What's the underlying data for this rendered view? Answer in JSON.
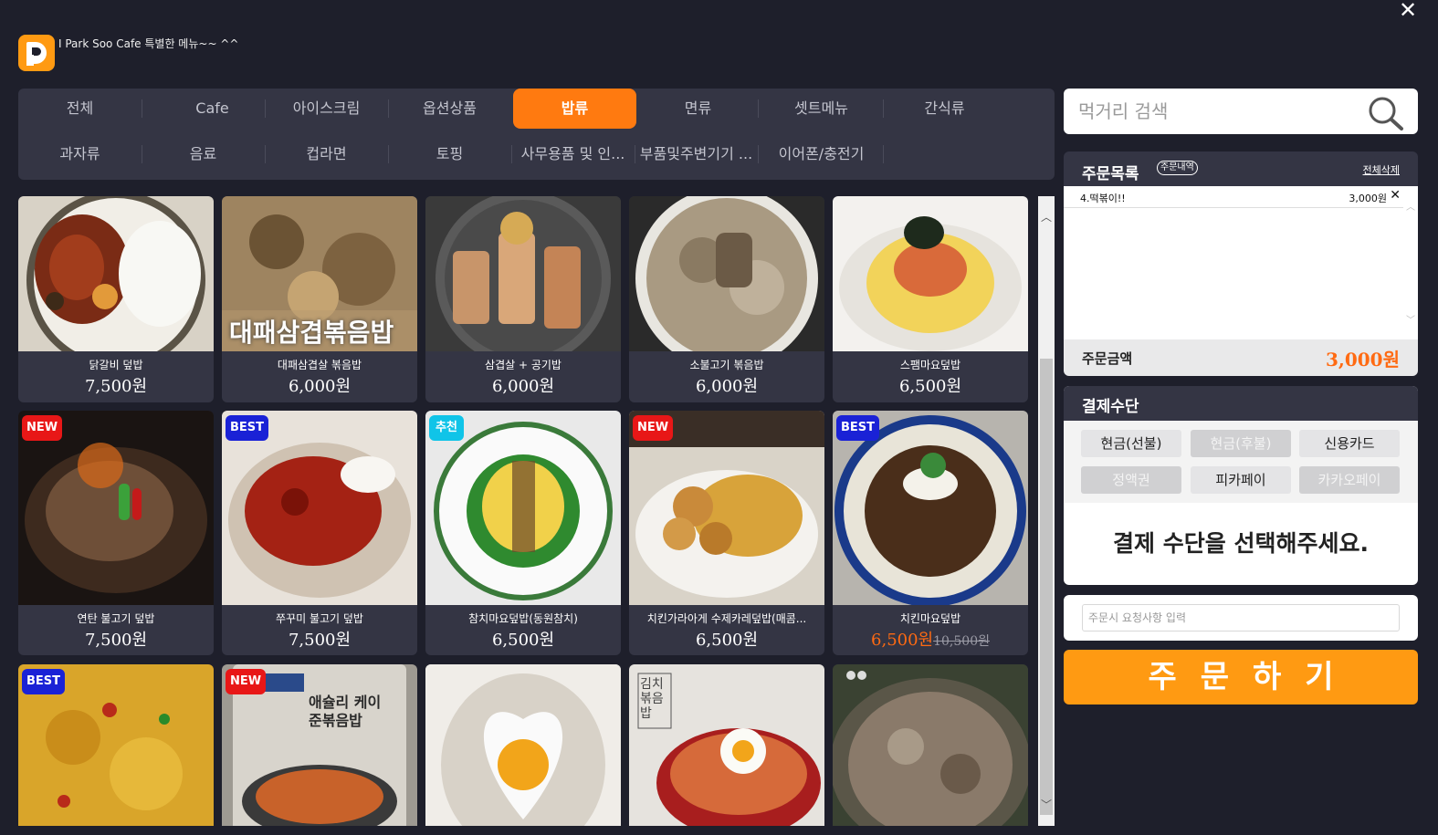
{
  "app": {
    "title": "I Park Soo Cafe 특별한 메뉴~~ ^^",
    "close": "✕"
  },
  "categories": [
    {
      "label": "전체"
    },
    {
      "label": "Cafe"
    },
    {
      "label": "아이스크림"
    },
    {
      "label": "옵션상품"
    },
    {
      "label": "밥류",
      "active": true
    },
    {
      "label": "면류"
    },
    {
      "label": "셋트메뉴"
    },
    {
      "label": "간식류"
    },
    {
      "label": "과자류"
    },
    {
      "label": "음료"
    },
    {
      "label": "컵라면"
    },
    {
      "label": "토핑"
    },
    {
      "label": "사무용품 및 인..."
    },
    {
      "label": "부품및주변기기 ..."
    },
    {
      "label": "이어폰/충전기"
    }
  ],
  "products": [
    {
      "name": "닭갈비 덮밥",
      "price": "7,500원"
    },
    {
      "name": "대패삼겹살 볶음밥",
      "price": "6,000원",
      "img_text": "대패삼겹볶음밥"
    },
    {
      "name": "삼겹살 + 공기밥",
      "price": "6,000원"
    },
    {
      "name": "소불고기 볶음밥",
      "price": "6,000원"
    },
    {
      "name": "스팸마요덮밥",
      "price": "6,500원"
    },
    {
      "name": "연탄 불고기 덮밥",
      "price": "7,500원",
      "badge": "NEW"
    },
    {
      "name": "쭈꾸미 불고기 덮밥",
      "price": "7,500원",
      "badge": "BEST"
    },
    {
      "name": "참치마요덮밥(동원참치)",
      "price": "6,500원",
      "badge": "추천"
    },
    {
      "name": "치킨가라아게 수제카레덮밥(매콤...",
      "price": "6,500원",
      "badge": "NEW"
    },
    {
      "name": "치킨마요덮밥",
      "price": "6,500원",
      "orig_price": "10,500원",
      "badge": "BEST"
    },
    {
      "badge": "BEST"
    },
    {
      "badge": "NEW",
      "img_text": "애슐리 케이준볶음밥"
    },
    {},
    {
      "img_text": "김치볶음밥"
    },
    {}
  ],
  "search": {
    "placeholder": "먹거리 검색"
  },
  "order": {
    "title": "주문목록",
    "history_label": "주문내역",
    "clear_all": "전체삭제",
    "items": [
      {
        "name": "4.떡볶이!!",
        "price": "3,000원"
      }
    ],
    "total_label": "주문금액",
    "total": "3,000원"
  },
  "payment": {
    "title": "결제수단",
    "options": [
      {
        "label": "현금(선불)",
        "enabled": true
      },
      {
        "label": "현금(후불)",
        "enabled": false
      },
      {
        "label": "신용카드",
        "enabled": true
      },
      {
        "label": "정액권",
        "enabled": false
      },
      {
        "label": "피카페이",
        "enabled": true
      },
      {
        "label": "카카오페이",
        "enabled": false
      }
    ],
    "message": "결제 수단을 선택해주세요."
  },
  "request": {
    "placeholder": "주문시 요청사항 입력"
  },
  "order_button": "주문하기",
  "colors": {
    "accent": "#ff9a12",
    "active_tab": "#ff7a10",
    "sale": "#ff6a12",
    "panel": "#343544",
    "background": "#1e1f2b"
  }
}
